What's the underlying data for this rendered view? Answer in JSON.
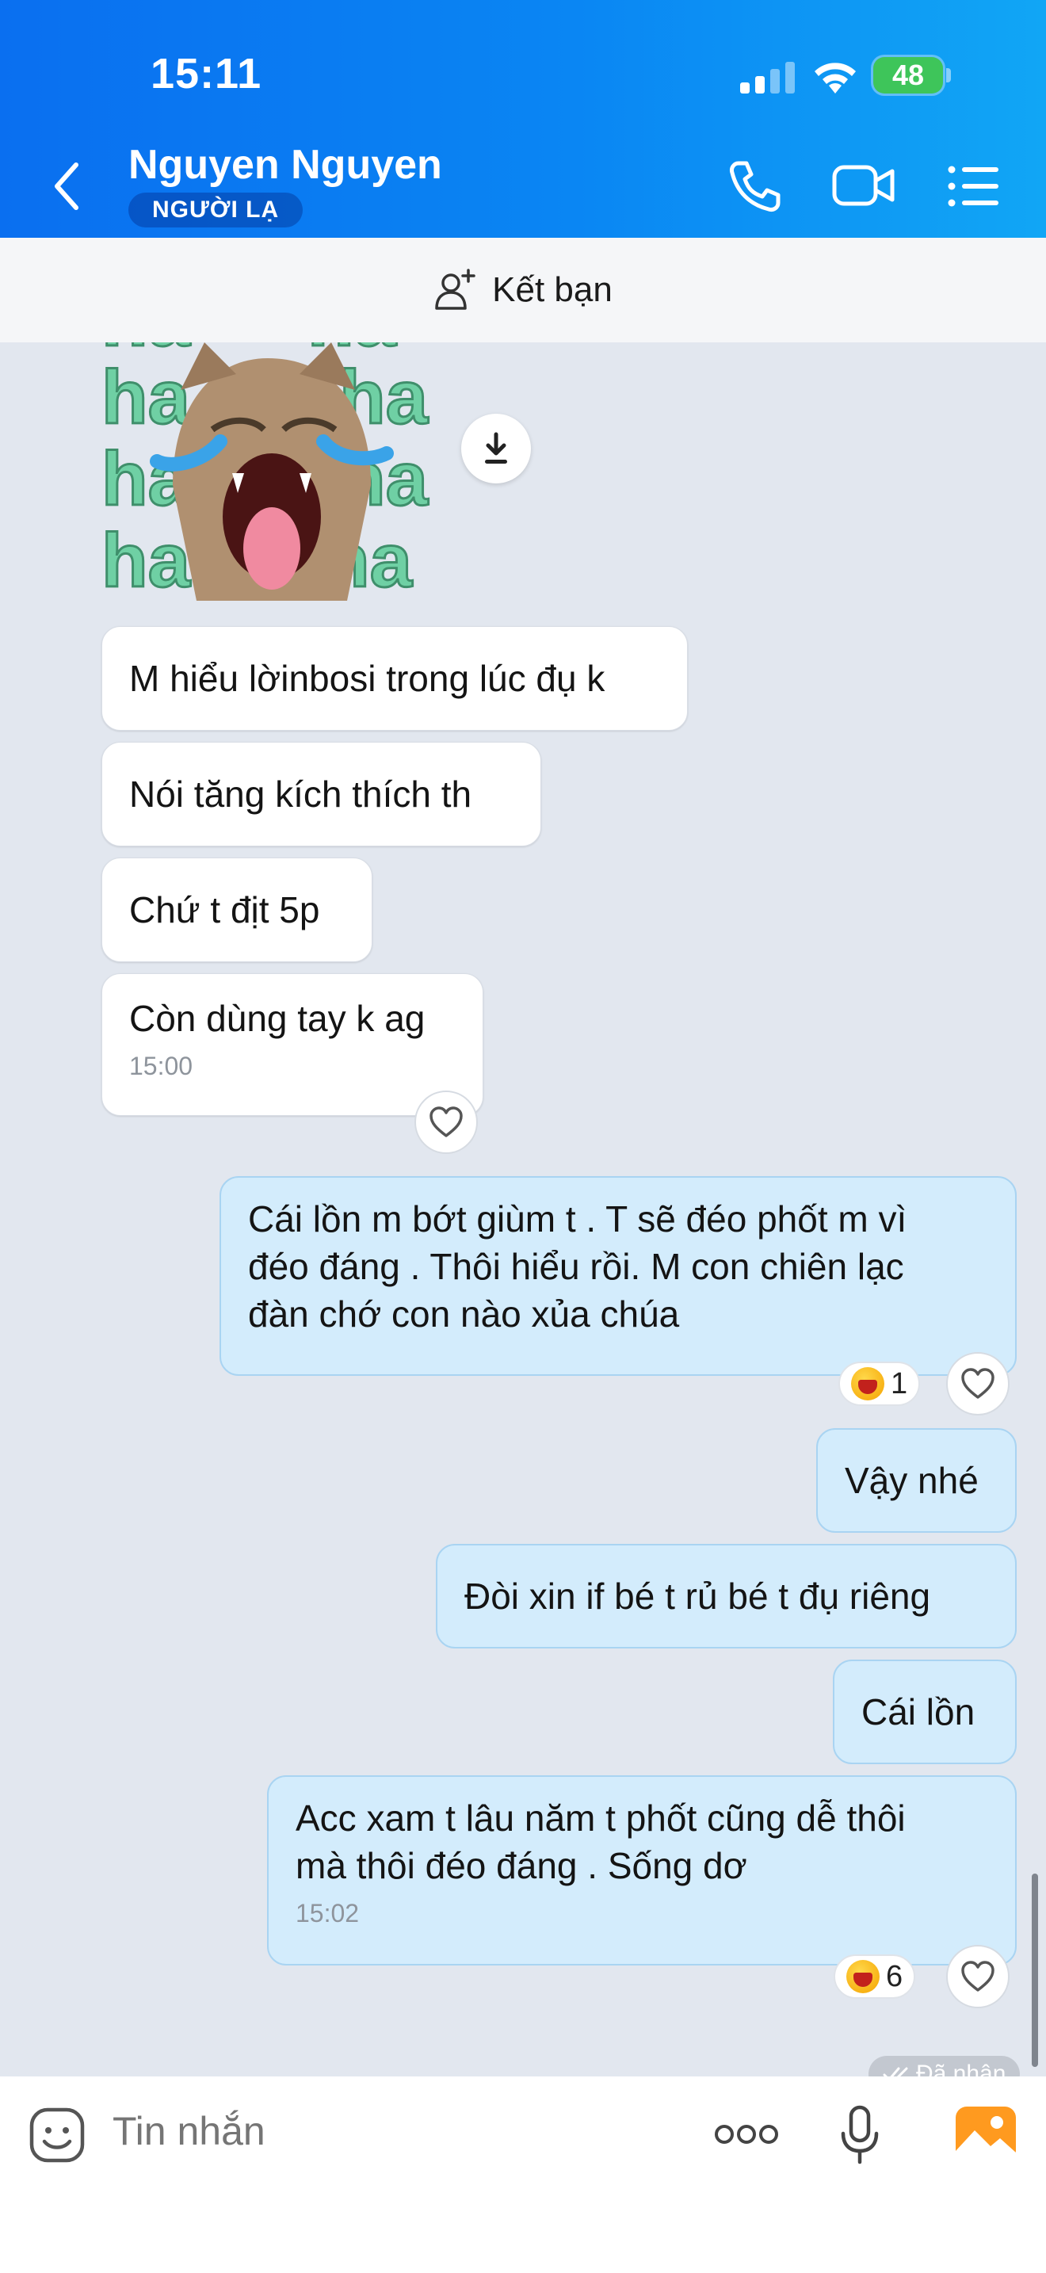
{
  "status_bar": {
    "time": "15:11",
    "battery": "48"
  },
  "header": {
    "name": "Nguyen Nguyen",
    "badge": "NGƯỜI LẠ",
    "icons": [
      "back-icon",
      "phone-icon",
      "video-call-icon",
      "menu-list-icon"
    ]
  },
  "friend_bar": {
    "label": "Kết bạn",
    "icon": "add-person-icon"
  },
  "sticker": {
    "text": "ha ha ha",
    "icon": "download-icon"
  },
  "messages_in": [
    {
      "text": "M hiểu lờinbosi trong lúc đụ k"
    },
    {
      "text": "Nói tăng kích thích th"
    },
    {
      "text": "Chứ t địt 5p"
    },
    {
      "text": "Còn dùng tay k ag",
      "time": "15:00"
    }
  ],
  "messages_out": [
    {
      "line1": "Cái lồn m bớt giùm t . T sẽ đéo phốt m vì",
      "line2": "đéo đáng . Thôi hiểu rồi. M con chiên lạc",
      "line3": "đàn chớ con nào xủa chúa",
      "reaction_count": "1"
    },
    {
      "text": "Vậy nhé"
    },
    {
      "text": "Đòi xin if bé t rủ bé t đụ riêng"
    },
    {
      "text": "Cái lồn"
    },
    {
      "line1": "Acc xam t lâu năm t phốt cũng dễ thôi",
      "line2": "mà thôi đéo đáng . Sống dơ",
      "time": "15:02",
      "reaction_count": "6"
    }
  ],
  "receipt": {
    "label": "Đã nhận"
  },
  "input": {
    "placeholder": "Tin nhắn",
    "icons": [
      "sticker-icon",
      "more-icon",
      "microphone-icon",
      "image-icon"
    ]
  },
  "colors": {
    "header_start": "#0a6ff0",
    "header_end": "#11a6f5",
    "outgoing_bubble": "#d3ecfc",
    "chat_bg": "#e2e7ef"
  }
}
